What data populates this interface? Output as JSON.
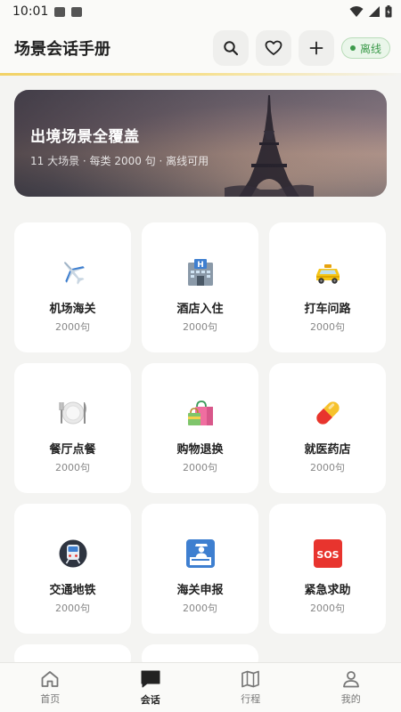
{
  "status": {
    "time": "10:01"
  },
  "header": {
    "title": "场景会话手册",
    "offline_label": "离线"
  },
  "hero": {
    "title": "出境场景全覆盖",
    "subtitle": "11 大场景 · 每类 2000 句 · 离线可用"
  },
  "categories": [
    {
      "name": "机场海关",
      "count": "2000句",
      "icon": "airplane-icon"
    },
    {
      "name": "酒店入住",
      "count": "2000句",
      "icon": "hotel-icon"
    },
    {
      "name": "打车问路",
      "count": "2000句",
      "icon": "taxi-icon"
    },
    {
      "name": "餐厅点餐",
      "count": "2000句",
      "icon": "plate-cutlery-icon"
    },
    {
      "name": "购物退换",
      "count": "2000句",
      "icon": "shopping-bags-icon"
    },
    {
      "name": "就医药店",
      "count": "2000句",
      "icon": "pill-icon"
    },
    {
      "name": "交通地铁",
      "count": "2000句",
      "icon": "metro-icon"
    },
    {
      "name": "海关申报",
      "count": "2000句",
      "icon": "customs-officer-icon"
    },
    {
      "name": "紧急求助",
      "count": "2000句",
      "icon": "sos-icon"
    }
  ],
  "nav": {
    "items": [
      {
        "label": "首页",
        "icon": "home-icon"
      },
      {
        "label": "会话",
        "icon": "chat-icon",
        "active": true
      },
      {
        "label": "行程",
        "icon": "map-icon"
      },
      {
        "label": "我的",
        "icon": "person-icon"
      }
    ]
  },
  "colors": {
    "accent": "#f2d266",
    "offline_green": "#3c9a4a",
    "background": "#f4f4f2"
  }
}
